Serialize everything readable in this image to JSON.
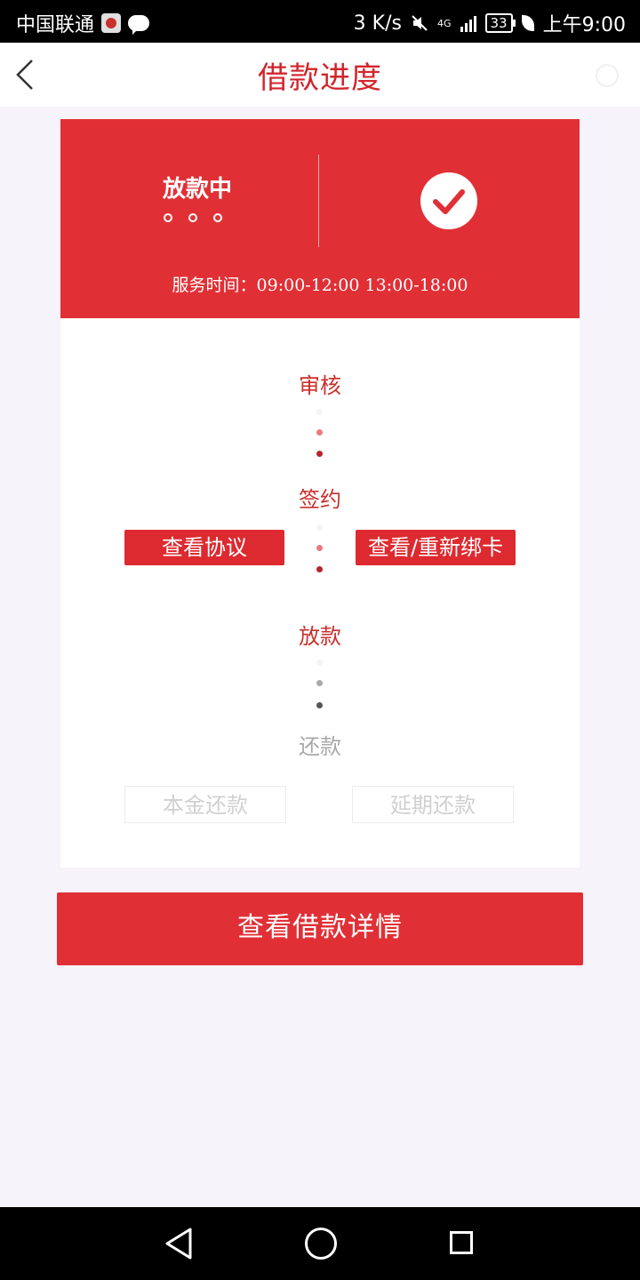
{
  "status_bar": {
    "carrier": "中国联通",
    "speed": "3 K/s",
    "network": "4G",
    "battery": "33",
    "time": "上午9:00"
  },
  "header": {
    "title": "借款进度"
  },
  "status_card": {
    "status": "放款中",
    "service_time": "服务时间：09:00-12:00 13:00-18:00"
  },
  "progress": {
    "steps": [
      {
        "label": "审核"
      },
      {
        "label": "签约"
      },
      {
        "label": "放款"
      },
      {
        "label": "还款"
      }
    ],
    "sign_buttons": {
      "view_agreement": "查看协议",
      "rebind_card": "查看/重新绑卡"
    },
    "repay_buttons": {
      "principal": "本金还款",
      "extend": "延期还款"
    }
  },
  "actions": {
    "view_detail": "查看借款详情"
  },
  "colors": {
    "primary": "#e03036",
    "step_active": "#c9302c",
    "step_inactive": "#a9a9a9",
    "background": "#f6f4fa"
  },
  "icons": [
    "back-icon",
    "refresh-icon",
    "check-circle-icon",
    "nav-back-icon",
    "nav-home-icon",
    "nav-recent-icon"
  ]
}
